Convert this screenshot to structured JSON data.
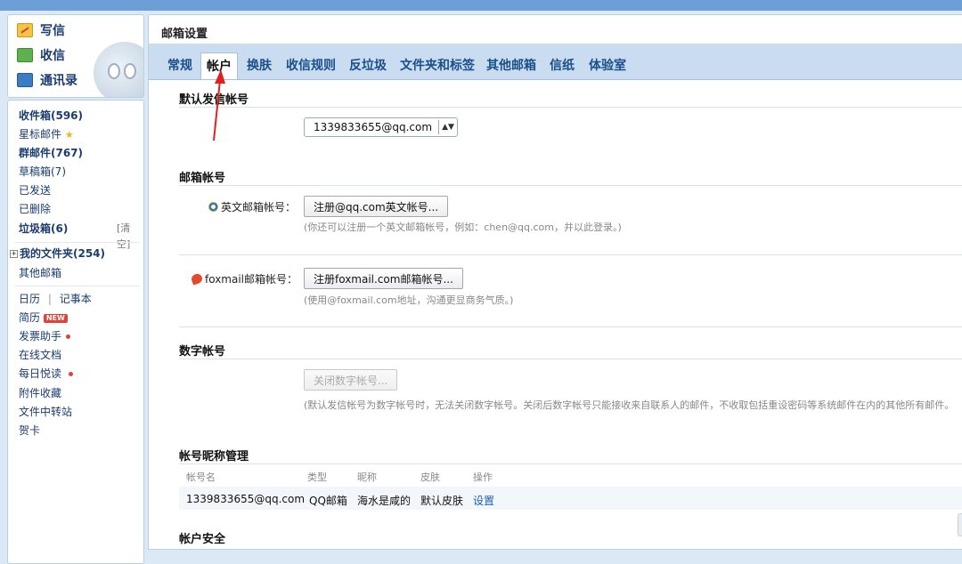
{
  "sidebar": {
    "compose": {
      "write_label": "写信",
      "receive_label": "收信",
      "contacts_label": "通讯录"
    },
    "folders": [
      {
        "label": "收件箱(596)"
      },
      {
        "label": "星标邮件"
      },
      {
        "label": "群邮件(767)"
      },
      {
        "label": "草稿箱(7)"
      },
      {
        "label": "已发送"
      },
      {
        "label": "已删除"
      },
      {
        "label": "垃圾箱(6)"
      }
    ],
    "clear_label": "[清空]",
    "my_folders_label": "我的文件夹(254)",
    "other_mailbox_label": "其他邮箱",
    "calendar_label": "日历",
    "divider": "|",
    "notepad_label": "记事本",
    "apps": [
      {
        "label": "简历"
      },
      {
        "label": "发票助手"
      },
      {
        "label": "在线文档"
      },
      {
        "label": "每日悦读"
      },
      {
        "label": "附件收藏"
      },
      {
        "label": "文件中转站"
      },
      {
        "label": "贺卡"
      }
    ],
    "new_badge": "NEW"
  },
  "main": {
    "title": "邮箱设置",
    "tabs": [
      {
        "label": "常规"
      },
      {
        "label": "帐户"
      },
      {
        "label": "换肤"
      },
      {
        "label": "收信规则"
      },
      {
        "label": "反垃圾"
      },
      {
        "label": "文件夹和标签"
      },
      {
        "label": "其他邮箱"
      },
      {
        "label": "信纸"
      },
      {
        "label": "体验室"
      }
    ],
    "active_tab": "帐户",
    "default_sender": {
      "title": "默认发信帐号",
      "selected": "1339833655@qq.com"
    },
    "mail_accounts": {
      "title": "邮箱帐号",
      "english_label": "英文邮箱帐号：",
      "english_button": "注册@qq.com英文帐号...",
      "english_hint": "(你还可以注册一个英文邮箱帐号，例如：chen@qq.com，并以此登录。)",
      "foxmail_label": "foxmail邮箱帐号：",
      "foxmail_button": "注册foxmail.com邮箱帐号...",
      "foxmail_hint": "(使用@foxmail.com地址，沟通更显商务气质。)"
    },
    "numeric_account": {
      "title": "数字帐号",
      "button": "关闭数字帐号...",
      "hint": "(默认发信帐号为数字帐号时，无法关闭数字帐号。关闭后数字帐号只能接收来自联系人的邮件，不收取包括重设密码等系统邮件在内的其他所有邮件。"
    },
    "nickname": {
      "title": "帐号昵称管理",
      "headers": [
        "帐号名",
        "类型",
        "昵称",
        "皮肤",
        "操作"
      ],
      "row": {
        "account": "1339833655@qq.com",
        "type": "QQ邮箱",
        "nickname": "海水是咸的",
        "skin": "默认皮肤",
        "action": "设置"
      }
    },
    "security": {
      "title": "帐户安全"
    }
  },
  "colors": {
    "accent": "#1a4f8a",
    "annotation_arrow": "#e02020",
    "tab_bar": "#c9dcf0"
  }
}
